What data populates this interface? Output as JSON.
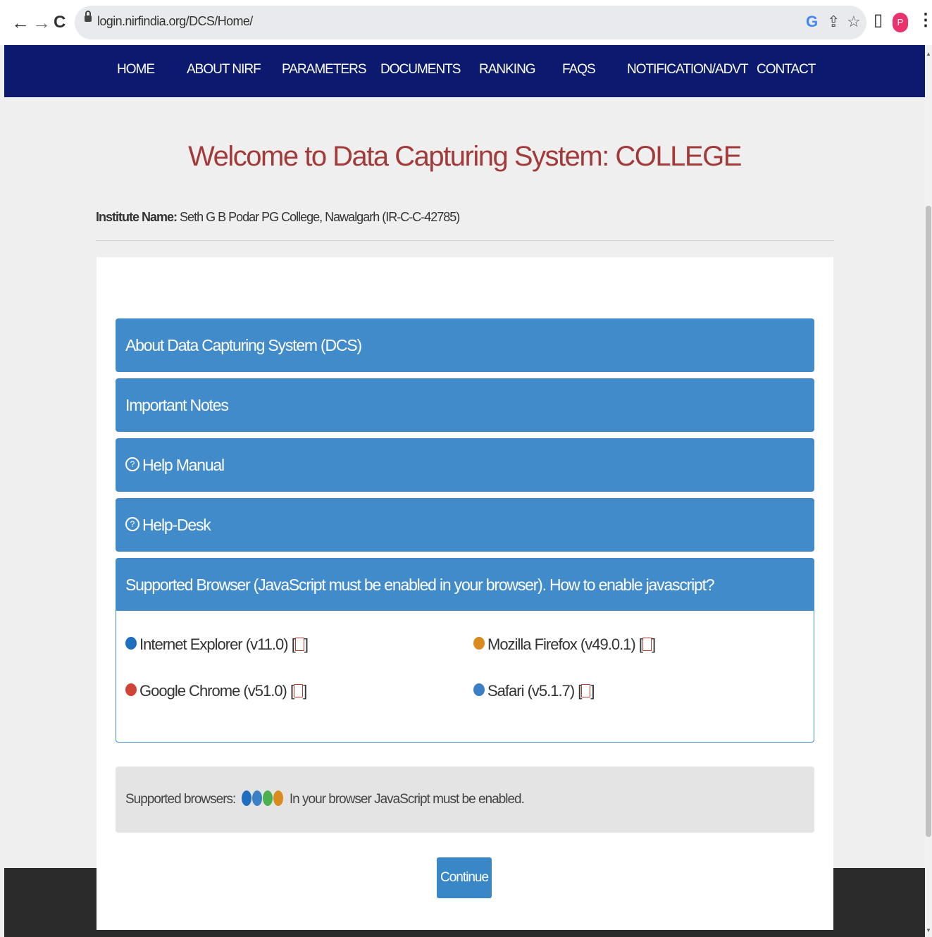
{
  "browser": {
    "back": "←",
    "forward": "→",
    "reload": "C",
    "url": "login.nirfindia.org/DCS/Home/",
    "profile_initial": "P"
  },
  "nav": {
    "items": [
      {
        "label": "HOME"
      },
      {
        "label": "ABOUT NIRF"
      },
      {
        "label": "PARAMETERS"
      },
      {
        "label": "DOCUMENTS"
      },
      {
        "label": "RANKING"
      },
      {
        "label": "FAQS"
      },
      {
        "label": "NOTIFICATION/ADVT"
      },
      {
        "label": "CONTACT"
      }
    ]
  },
  "page": {
    "title": "Welcome to Data Capturing System: COLLEGE",
    "institute_label": "Institute Name:",
    "institute_value": "Seth G B Podar PG College, Nawalgarh (IR-C-C-42785)"
  },
  "panels": [
    {
      "label": "About Data Capturing System (DCS)"
    },
    {
      "label": "Important Notes"
    },
    {
      "label": "Help Manual"
    },
    {
      "label": "Help-Desk"
    },
    {
      "label": "Supported Browser (JavaScript must be enabled in your browser). How to enable javascript?"
    }
  ],
  "browsers": [
    {
      "name": "Internet Explorer (v11.0)",
      "icon": "ie-icon",
      "color": "#1e6fc0"
    },
    {
      "name": "Mozilla Firefox (v49.0.1)",
      "icon": "firefox-icon",
      "color": "#d98b1f"
    },
    {
      "name": "Google Chrome (v51.0)",
      "icon": "chrome-icon",
      "color": "#d04437"
    },
    {
      "name": "Safari (v5.1.7)",
      "icon": "safari-icon",
      "color": "#3b7fc4"
    }
  ],
  "notice": {
    "prefix": "Supported browsers:",
    "suffix": "In your browser JavaScript must be enabled."
  },
  "continue_label": "Continue",
  "colors": {
    "navbar": "#0b1a6e",
    "panel": "#428bca",
    "title": "#a33a3a"
  }
}
